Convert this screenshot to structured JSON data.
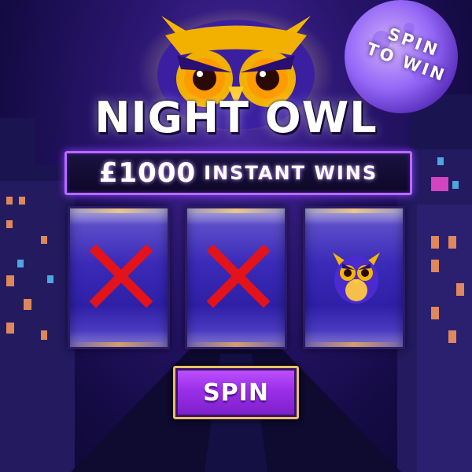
{
  "game": {
    "title": "NIGHT OWL",
    "badge": {
      "line1": "SPIN",
      "line2": "TO WIN"
    },
    "prize": {
      "amount": "£1000",
      "text": "INSTANT WINS"
    },
    "reels": [
      {
        "symbol": "cross",
        "icon": "red-x"
      },
      {
        "symbol": "cross",
        "icon": "red-x"
      },
      {
        "symbol": "owl",
        "icon": "owl"
      }
    ],
    "spin_button": {
      "label": "SPIN"
    }
  },
  "colors": {
    "background": "#1b0f55",
    "moon": "#9a6cff",
    "banner_border": "#b86bff",
    "reel_fill": "#3a2ab8",
    "cross_red": "#e2131a",
    "button_purple": "#9b2fe8",
    "button_gold": "#e6c06a"
  }
}
